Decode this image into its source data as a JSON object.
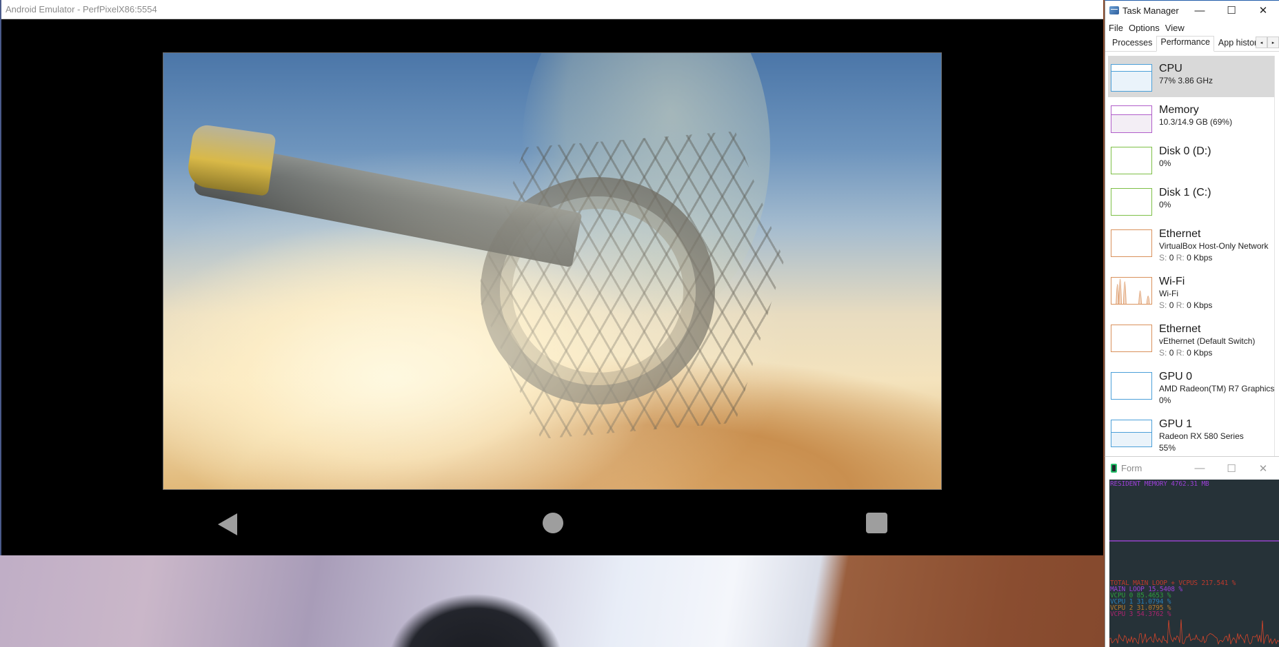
{
  "emulator": {
    "title": "Android Emulator - PerfPixelX86:5554",
    "nav": {
      "back_icon": "back-triangle-icon",
      "home_icon": "home-circle-icon",
      "recents_icon": "recents-square-icon"
    },
    "game_scene": "space station scene above planet"
  },
  "task_manager": {
    "title": "Task Manager",
    "window_controls": {
      "minimize": "—",
      "maximize": "☐",
      "close": "✕"
    },
    "menu": [
      "File",
      "Options",
      "View"
    ],
    "tabs": [
      {
        "label": "Processes",
        "active": false
      },
      {
        "label": "Performance",
        "active": true
      },
      {
        "label": "App history",
        "active": false
      }
    ],
    "tab_scroll": {
      "left": "◂",
      "right": "▸"
    },
    "items": [
      {
        "name": "CPU",
        "sub1": "77%  3.86 GHz",
        "color": "#4a9fd8",
        "fill": "#eaf3fa",
        "selected": true,
        "usage_pct": 77
      },
      {
        "name": "Memory",
        "sub1": "10.3/14.9 GB (69%)",
        "color": "#b05cc9",
        "fill": "#f3eef5",
        "usage_pct": 69
      },
      {
        "name": "Disk 0 (D:)",
        "sub1": "0%",
        "color": "#7cbf45",
        "usage_pct": 0
      },
      {
        "name": "Disk 1 (C:)",
        "sub1": "0%",
        "color": "#7cbf45",
        "usage_pct": 0
      },
      {
        "name": "Ethernet",
        "sub1": "VirtualBox Host-Only Network",
        "s_label": "S:",
        "s_val": "0",
        "r_label": "R:",
        "r_val": "0 Kbps",
        "color": "#d9905a"
      },
      {
        "name": "Wi-Fi",
        "sub1": "Wi-Fi",
        "s_label": "S:",
        "s_val": "0",
        "r_label": "R:",
        "r_val": "0 Kbps",
        "color": "#d9905a"
      },
      {
        "name": "Ethernet",
        "sub1": "vEthernet (Default Switch)",
        "s_label": "S:",
        "s_val": "0",
        "r_label": "R:",
        "r_val": "0 Kbps",
        "color": "#d9905a"
      },
      {
        "name": "GPU 0",
        "sub1": "AMD Radeon(TM) R7 Graphics",
        "sub2": "0%",
        "color": "#4a9fd8",
        "usage_pct": 0
      },
      {
        "name": "GPU 1",
        "sub1": "Radeon RX 580 Series",
        "sub2": "55%",
        "color": "#4a9fd8",
        "fill": "#eaf3fa",
        "usage_pct": 55
      }
    ]
  },
  "form": {
    "title": "Form",
    "window_controls": {
      "minimize": "—",
      "maximize": "☐",
      "close": "✕"
    },
    "resident_memory": {
      "text": "RESIDENT MEMORY 4762.31 MB",
      "color": "#9b3fd6"
    },
    "stats": [
      {
        "text": "TOTAL MAIN LOOP + VCPUS 217.541 %",
        "color": "#c0392b"
      },
      {
        "text": "MAIN LOOP 15.5408 %",
        "color": "#9b3fd6"
      },
      {
        "text": "VCPU 0 85.4653 %",
        "color": "#2e9e3e"
      },
      {
        "text": "VCPU 1 31.0794 %",
        "color": "#2a7fb8"
      },
      {
        "text": "VCPU 2 31.0795 %",
        "color": "#b5782a"
      },
      {
        "text": "VCPU 3 54.3762 %",
        "color": "#a8246e"
      }
    ],
    "graph_color": "#d8452a"
  }
}
